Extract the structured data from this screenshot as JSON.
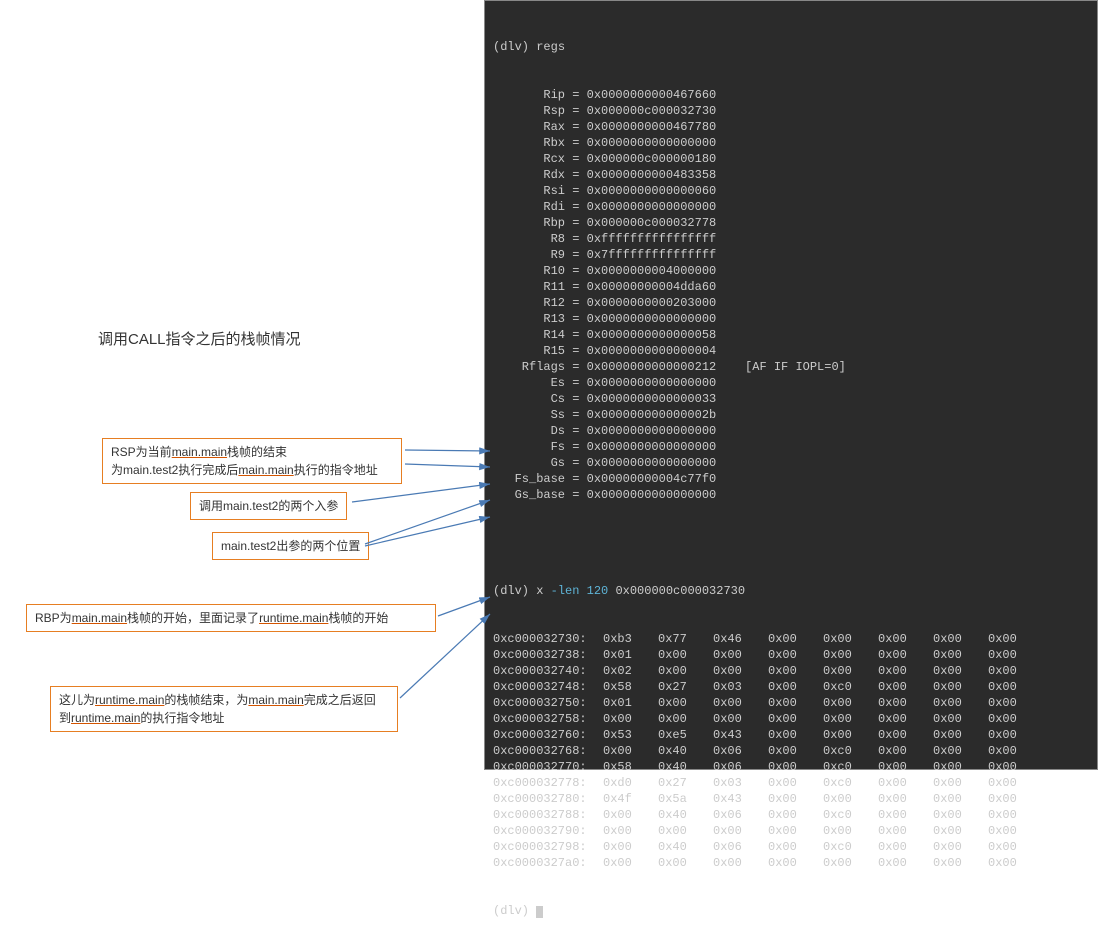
{
  "title": "调用CALL指令之后的栈帧情况",
  "terminal": {
    "prompt": "(dlv)",
    "regs_cmd": "regs",
    "registers": [
      {
        "name": "Rip",
        "value": "0x0000000000467660"
      },
      {
        "name": "Rsp",
        "value": "0x000000c000032730"
      },
      {
        "name": "Rax",
        "value": "0x0000000000467780"
      },
      {
        "name": "Rbx",
        "value": "0x0000000000000000"
      },
      {
        "name": "Rcx",
        "value": "0x000000c000000180"
      },
      {
        "name": "Rdx",
        "value": "0x0000000000483358"
      },
      {
        "name": "Rsi",
        "value": "0x0000000000000060"
      },
      {
        "name": "Rdi",
        "value": "0x0000000000000000"
      },
      {
        "name": "Rbp",
        "value": "0x000000c000032778"
      },
      {
        "name": "R8",
        "value": "0xffffffffffffffff"
      },
      {
        "name": "R9",
        "value": "0x7fffffffffffffff"
      },
      {
        "name": "R10",
        "value": "0x0000000004000000"
      },
      {
        "name": "R11",
        "value": "0x00000000004dda60"
      },
      {
        "name": "R12",
        "value": "0x0000000000203000"
      },
      {
        "name": "R13",
        "value": "0x0000000000000000"
      },
      {
        "name": "R14",
        "value": "0x0000000000000058"
      },
      {
        "name": "R15",
        "value": "0x0000000000000004"
      },
      {
        "name": "Rflags",
        "value": "0x0000000000000212",
        "extra": "[AF IF IOPL=0]"
      },
      {
        "name": "Es",
        "value": "0x0000000000000000"
      },
      {
        "name": "Cs",
        "value": "0x0000000000000033"
      },
      {
        "name": "Ss",
        "value": "0x000000000000002b"
      },
      {
        "name": "Ds",
        "value": "0x0000000000000000"
      },
      {
        "name": "Fs",
        "value": "0x0000000000000000"
      },
      {
        "name": "Gs",
        "value": "0x0000000000000000"
      },
      {
        "name": "Fs_base",
        "value": "0x00000000004c77f0"
      },
      {
        "name": "Gs_base",
        "value": "0x0000000000000000"
      }
    ],
    "mem_cmd_prefix": "x",
    "mem_cmd_args": "-len 120",
    "mem_cmd_addr": "0x000000c000032730",
    "memory": [
      {
        "addr": "0xc000032730:",
        "bytes": [
          "0xb3",
          "0x77",
          "0x46",
          "0x00",
          "0x00",
          "0x00",
          "0x00",
          "0x00"
        ]
      },
      {
        "addr": "0xc000032738:",
        "bytes": [
          "0x01",
          "0x00",
          "0x00",
          "0x00",
          "0x00",
          "0x00",
          "0x00",
          "0x00"
        ]
      },
      {
        "addr": "0xc000032740:",
        "bytes": [
          "0x02",
          "0x00",
          "0x00",
          "0x00",
          "0x00",
          "0x00",
          "0x00",
          "0x00"
        ]
      },
      {
        "addr": "0xc000032748:",
        "bytes": [
          "0x58",
          "0x27",
          "0x03",
          "0x00",
          "0xc0",
          "0x00",
          "0x00",
          "0x00"
        ]
      },
      {
        "addr": "0xc000032750:",
        "bytes": [
          "0x01",
          "0x00",
          "0x00",
          "0x00",
          "0x00",
          "0x00",
          "0x00",
          "0x00"
        ]
      },
      {
        "addr": "0xc000032758:",
        "bytes": [
          "0x00",
          "0x00",
          "0x00",
          "0x00",
          "0x00",
          "0x00",
          "0x00",
          "0x00"
        ]
      },
      {
        "addr": "0xc000032760:",
        "bytes": [
          "0x53",
          "0xe5",
          "0x43",
          "0x00",
          "0x00",
          "0x00",
          "0x00",
          "0x00"
        ]
      },
      {
        "addr": "0xc000032768:",
        "bytes": [
          "0x00",
          "0x40",
          "0x06",
          "0x00",
          "0xc0",
          "0x00",
          "0x00",
          "0x00"
        ]
      },
      {
        "addr": "0xc000032770:",
        "bytes": [
          "0x58",
          "0x40",
          "0x06",
          "0x00",
          "0xc0",
          "0x00",
          "0x00",
          "0x00"
        ]
      },
      {
        "addr": "0xc000032778:",
        "bytes": [
          "0xd0",
          "0x27",
          "0x03",
          "0x00",
          "0xc0",
          "0x00",
          "0x00",
          "0x00"
        ]
      },
      {
        "addr": "0xc000032780:",
        "bytes": [
          "0x4f",
          "0x5a",
          "0x43",
          "0x00",
          "0x00",
          "0x00",
          "0x00",
          "0x00"
        ]
      },
      {
        "addr": "0xc000032788:",
        "bytes": [
          "0x00",
          "0x40",
          "0x06",
          "0x00",
          "0xc0",
          "0x00",
          "0x00",
          "0x00"
        ]
      },
      {
        "addr": "0xc000032790:",
        "bytes": [
          "0x00",
          "0x00",
          "0x00",
          "0x00",
          "0x00",
          "0x00",
          "0x00",
          "0x00"
        ]
      },
      {
        "addr": "0xc000032798:",
        "bytes": [
          "0x00",
          "0x40",
          "0x06",
          "0x00",
          "0xc0",
          "0x00",
          "0x00",
          "0x00"
        ]
      },
      {
        "addr": "0xc0000327a0:",
        "bytes": [
          "0x00",
          "0x00",
          "0x00",
          "0x00",
          "0x00",
          "0x00",
          "0x00",
          "0x00"
        ]
      }
    ]
  },
  "callouts": {
    "c1_line1_a": "RSP为当前",
    "c1_line1_b": "main.main",
    "c1_line1_c": "栈帧的结束",
    "c1_line2_a": "为main.test2执行完成后",
    "c1_line2_b": "main.main",
    "c1_line2_c": "执行的指令地址",
    "c2": "调用main.test2的两个入参",
    "c3": "main.test2出参的两个位置",
    "c4_a": "RBP为",
    "c4_b": "main.main",
    "c4_c": "栈帧的开始，里面记录了",
    "c4_d": "runtime.main",
    "c4_e": "栈帧的开始",
    "c5_a": "这儿为",
    "c5_b": "runtime.main",
    "c5_c": "的栈帧结束，为",
    "c5_d": "main.main",
    "c5_e": "完成之后返回",
    "c5_f": "到",
    "c5_g": "runtime.main",
    "c5_h": "的执行指令地址"
  }
}
